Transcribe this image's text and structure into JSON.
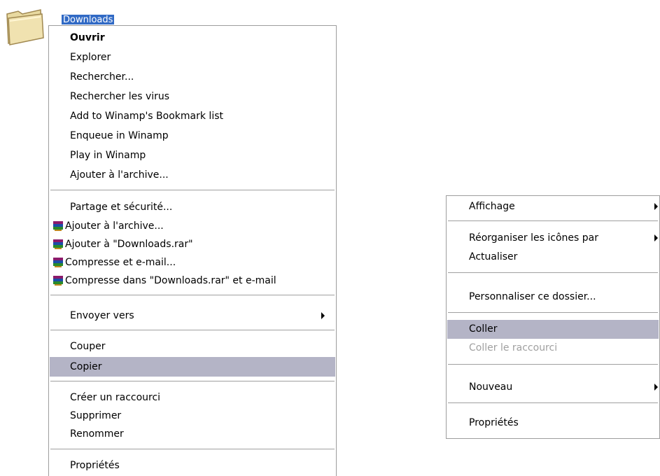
{
  "desktop": {
    "folder_label": "Downloads"
  },
  "context_menu": {
    "items": [
      {
        "label": "Ouvrir",
        "bold": true
      },
      {
        "label": "Explorer"
      },
      {
        "label": "Rechercher..."
      },
      {
        "label": "Rechercher les virus"
      },
      {
        "label": "Add to Winamp's Bookmark list"
      },
      {
        "label": "Enqueue in Winamp"
      },
      {
        "label": "Play in Winamp"
      },
      {
        "label": "Ajouter à l'archive..."
      },
      {
        "label": "Partage et sécurité..."
      },
      {
        "label": "Ajouter à l'archive...",
        "icon": "winrar-icon"
      },
      {
        "label": "Ajouter à \"Downloads.rar\"",
        "icon": "winrar-icon"
      },
      {
        "label": "Compresse et e-mail...",
        "icon": "winrar-icon"
      },
      {
        "label": "Compresse dans \"Downloads.rar\" et e-mail",
        "icon": "winrar-icon"
      },
      {
        "label": "Envoyer vers",
        "submenu": true
      },
      {
        "label": "Couper"
      },
      {
        "label": "Copier",
        "highlighted": true
      },
      {
        "label": "Créer un raccourci"
      },
      {
        "label": "Supprimer"
      },
      {
        "label": "Renommer"
      },
      {
        "label": "Propriétés"
      }
    ]
  },
  "background_menu": {
    "items": [
      {
        "label": "Affichage",
        "submenu": true
      },
      {
        "label": "Réorganiser les icônes par",
        "submenu": true
      },
      {
        "label": "Actualiser"
      },
      {
        "label": "Personnaliser ce dossier..."
      },
      {
        "label": "Coller",
        "highlighted": true
      },
      {
        "label": "Coller le raccourci",
        "disabled": true
      },
      {
        "label": "Nouveau",
        "submenu": true
      },
      {
        "label": "Propriétés"
      }
    ]
  },
  "colors": {
    "highlight": "#b4b4c6",
    "selection": "#316ac5",
    "disabled_text": "#a0a0a0"
  }
}
